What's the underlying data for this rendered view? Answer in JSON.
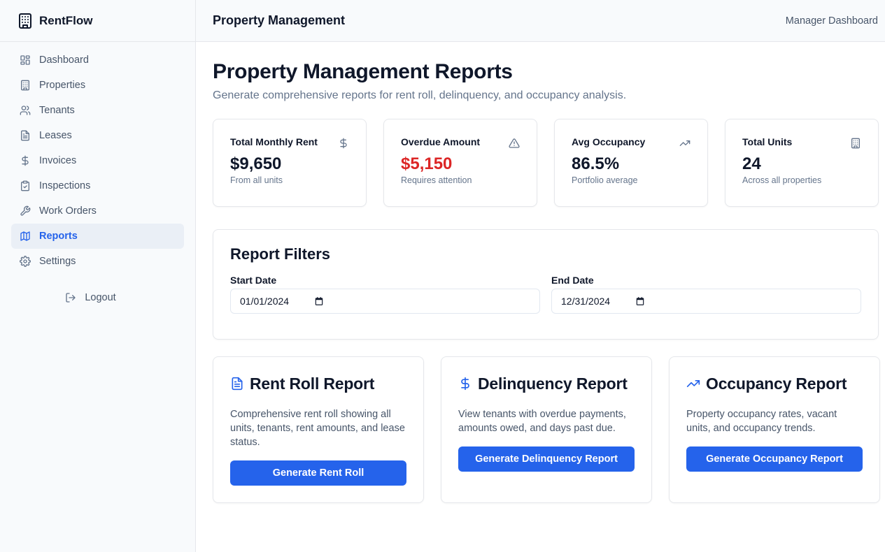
{
  "brand": {
    "name": "RentFlow",
    "icon": "building-icon"
  },
  "sidebar": {
    "items": [
      {
        "label": "Dashboard",
        "icon": "dashboard-icon",
        "active": false
      },
      {
        "label": "Properties",
        "icon": "building-icon",
        "active": false
      },
      {
        "label": "Tenants",
        "icon": "users-icon",
        "active": false
      },
      {
        "label": "Leases",
        "icon": "document-icon",
        "active": false
      },
      {
        "label": "Invoices",
        "icon": "dollar-icon",
        "active": false
      },
      {
        "label": "Inspections",
        "icon": "clipboard-check-icon",
        "active": false
      },
      {
        "label": "Work Orders",
        "icon": "wrench-icon",
        "active": false
      },
      {
        "label": "Reports",
        "icon": "map-icon",
        "active": true
      },
      {
        "label": "Settings",
        "icon": "gear-icon",
        "active": false
      }
    ],
    "logout": "Logout"
  },
  "topbar": {
    "title": "Property Management",
    "right": "Manager Dashboard"
  },
  "page": {
    "title": "Property Management Reports",
    "subtitle": "Generate comprehensive reports for rent roll, delinquency, and occupancy analysis."
  },
  "stats": [
    {
      "label": "Total Monthly Rent",
      "value": "$9,650",
      "note": "From all units",
      "icon": "dollar-icon"
    },
    {
      "label": "Overdue Amount",
      "value": "$5,150",
      "note": "Requires attention",
      "icon": "warning-icon",
      "value_color": "#dc2626"
    },
    {
      "label": "Avg Occupancy",
      "value": "86.5%",
      "note": "Portfolio average",
      "icon": "trending-up-icon"
    },
    {
      "label": "Total Units",
      "value": "24",
      "note": "Across all properties",
      "icon": "building-icon"
    }
  ],
  "filters": {
    "title": "Report Filters",
    "start": {
      "label": "Start Date",
      "value": "01/01/2024"
    },
    "end": {
      "label": "End Date",
      "value": "12/31/2024"
    }
  },
  "reports": [
    {
      "title": "Rent Roll Report",
      "icon": "document-icon",
      "description": "Comprehensive rent roll showing all units, tenants, rent amounts, and lease status.",
      "button": "Generate Rent Roll"
    },
    {
      "title": "Delinquency Report",
      "icon": "dollar-icon",
      "description": "View tenants with overdue payments, amounts owed, and days past due.",
      "button": "Generate Delinquency Report"
    },
    {
      "title": "Occupancy Report",
      "icon": "trending-up-icon",
      "description": "Property occupancy rates, vacant units, and occupancy trends.",
      "button": "Generate Occupancy Report"
    }
  ],
  "colors": {
    "accent": "#2563eb",
    "danger": "#dc2626",
    "sidebar_bg": "#f8fafc",
    "active_bg": "#eaeff6"
  }
}
